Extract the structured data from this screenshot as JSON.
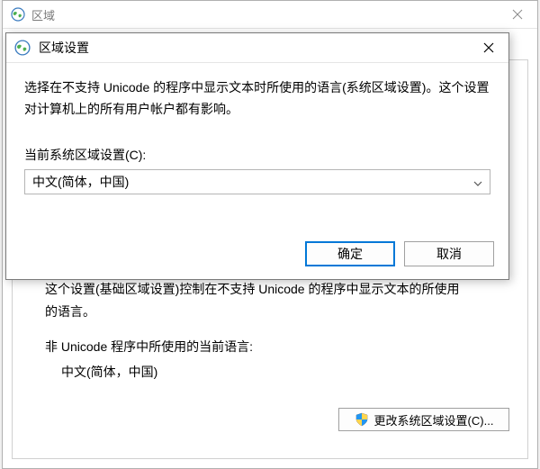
{
  "parent": {
    "title": "区域",
    "body_line1": "这个设置(基础区域设置)控制在不支持 Unicode 的程序中显示文本的所使用",
    "body_line2": "的语言。",
    "label_current": "非 Unicode 程序中所使用的当前语言:",
    "current_value": "中文(简体，中国)",
    "change_locale_button": "更改系统区域设置(C)..."
  },
  "dialog": {
    "title": "区域设置",
    "description": "选择在不支持 Unicode 的程序中显示文本时所使用的语言(系统区域设置)。这个设置对计算机上的所有用户帐户都有影响。",
    "field_label": "当前系统区域设置(C):",
    "selected_value": "中文(简体，中国)",
    "ok_label": "确定",
    "cancel_label": "取消"
  }
}
